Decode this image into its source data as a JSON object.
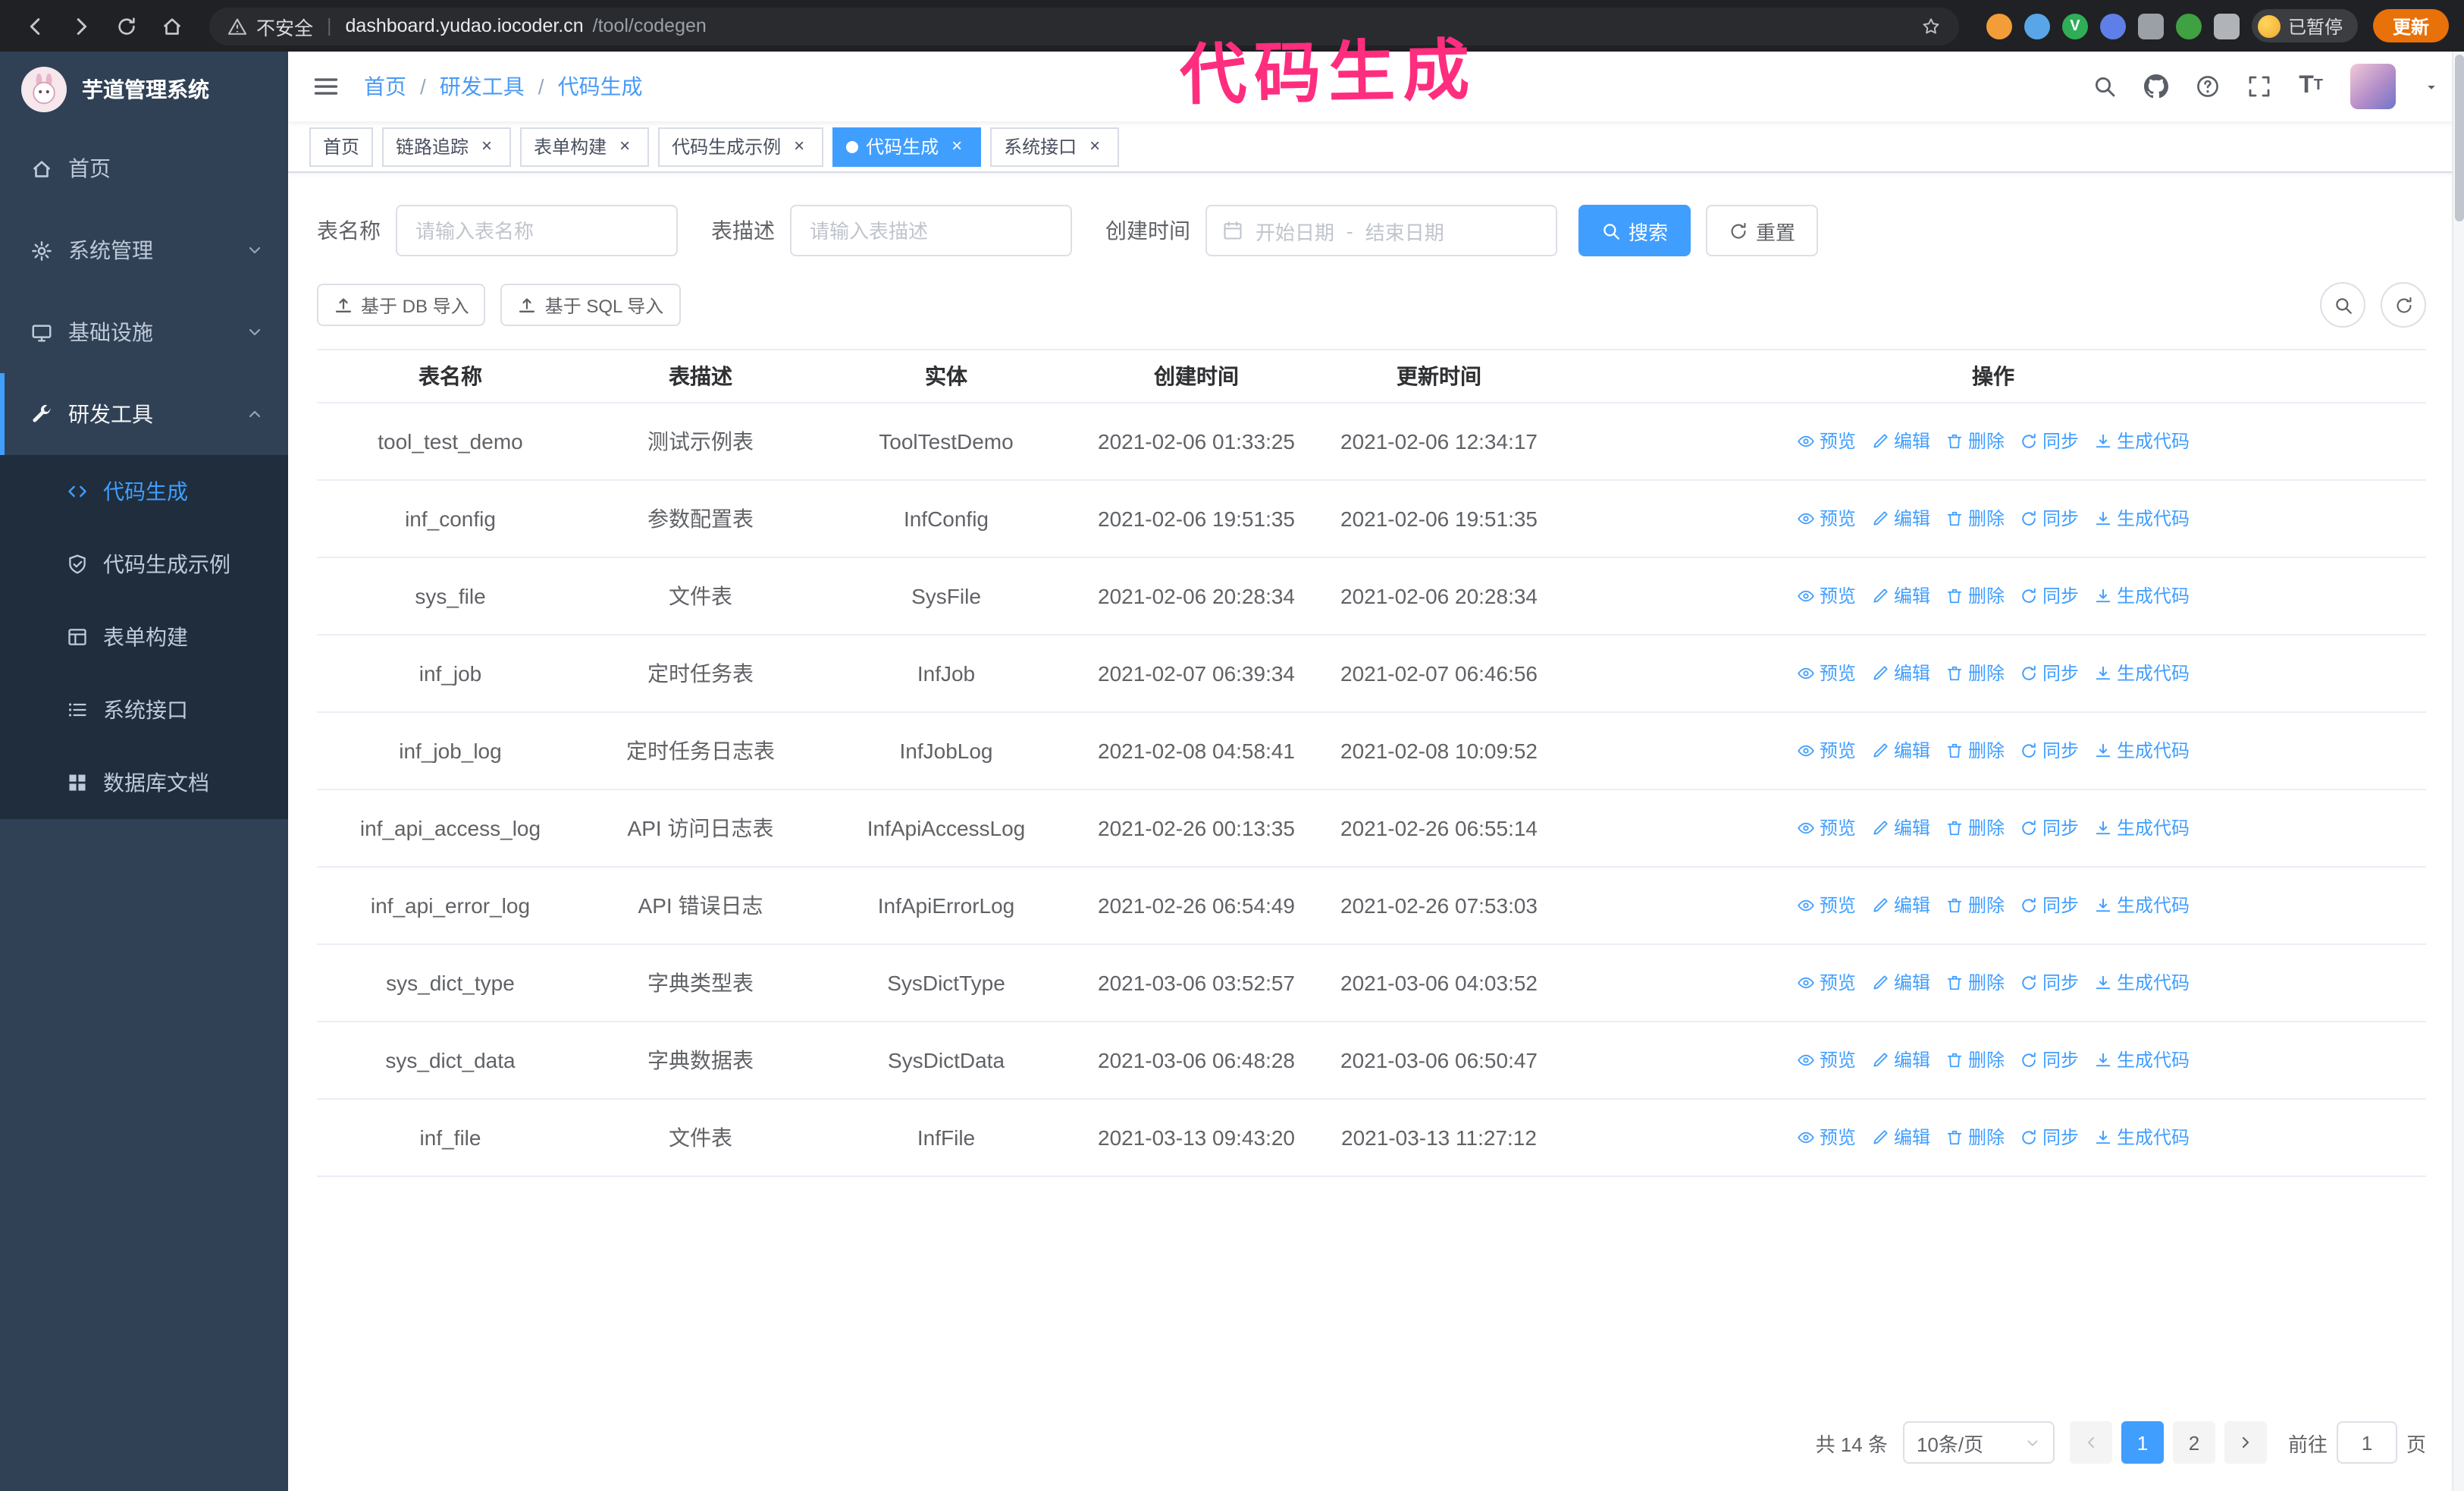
{
  "colors": {
    "accent": "#409eff",
    "sidebar_bg": "#304156",
    "submenu_bg": "#1f2d3d",
    "annotation_pink": "#ff2d7e",
    "update_button_orange": "#e8710a",
    "link_blue": "#4a9af5"
  },
  "browser": {
    "nav_icons": [
      "back",
      "forward",
      "reload",
      "home"
    ],
    "security_label": "不安全",
    "url_host": "dashboard.yudao.iocoder.cn",
    "url_path": "/tool/codegen",
    "extensions": [
      {
        "bg": "#f29d38",
        "shape": "circle",
        "glyph": ""
      },
      {
        "bg": "#58a6e8",
        "shape": "circle",
        "glyph": ""
      },
      {
        "bg": "#2fae57",
        "shape": "circle",
        "glyph": "V"
      },
      {
        "bg": "#5f7fe8",
        "shape": "circle",
        "glyph": ""
      },
      {
        "bg": "#9aa0a6",
        "shape": "square",
        "glyph": ""
      },
      {
        "bg": "#3fa142",
        "shape": "circle",
        "glyph": ""
      },
      {
        "bg": "#b0b3b8",
        "shape": "square",
        "glyph": ""
      }
    ],
    "paused_badge": "已暂停",
    "update_button": "更新"
  },
  "annotation": {
    "text": "代码生成"
  },
  "sidebar": {
    "logo_title": "芋道管理系统",
    "items": [
      {
        "key": "home",
        "label": "首页",
        "icon": "home",
        "chevron": null,
        "active": false
      },
      {
        "key": "system",
        "label": "系统管理",
        "icon": "gear",
        "chevron": "down",
        "active": false
      },
      {
        "key": "infra",
        "label": "基础设施",
        "icon": "monitor",
        "chevron": "down",
        "active": false
      },
      {
        "key": "devtools",
        "label": "研发工具",
        "icon": "wrench",
        "chevron": "up",
        "active": true
      }
    ],
    "subitems": [
      {
        "key": "codegen",
        "label": "代码生成",
        "icon": "code",
        "active": true
      },
      {
        "key": "codegen-example",
        "label": "代码生成示例",
        "icon": "shield",
        "active": false
      },
      {
        "key": "form-builder",
        "label": "表单构建",
        "icon": "form",
        "active": false
      },
      {
        "key": "api-doc",
        "label": "系统接口",
        "icon": "api",
        "active": false
      },
      {
        "key": "db-doc",
        "label": "数据库文档",
        "icon": "db",
        "active": false
      }
    ]
  },
  "breadcrumb": {
    "separator": "/",
    "items": [
      "首页",
      "研发工具",
      "代码生成"
    ]
  },
  "navbar": {
    "icons": [
      "search",
      "github",
      "question",
      "fullscreen",
      "font-size",
      "avatar",
      "caret-down"
    ]
  },
  "tabs": [
    {
      "key": "home",
      "label": "首页",
      "closable": false,
      "active": false
    },
    {
      "key": "trace",
      "label": "链路追踪",
      "closable": true,
      "active": false
    },
    {
      "key": "form-builder",
      "label": "表单构建",
      "closable": true,
      "active": false
    },
    {
      "key": "codegen-example",
      "label": "代码生成示例",
      "closable": true,
      "active": false
    },
    {
      "key": "codegen",
      "label": "代码生成",
      "closable": true,
      "active": true
    },
    {
      "key": "api-doc",
      "label": "系统接口",
      "closable": true,
      "active": false
    }
  ],
  "filters": {
    "table_name_label": "表名称",
    "table_name_placeholder": "请输入表名称",
    "table_desc_label": "表描述",
    "table_desc_placeholder": "请输入表描述",
    "create_time_label": "创建时间",
    "date_start_placeholder": "开始日期",
    "date_separator": "-",
    "date_end_placeholder": "结束日期",
    "search_button": "搜索",
    "reset_button": "重置"
  },
  "toolbar": {
    "import_db": "基于 DB 导入",
    "import_sql": "基于 SQL 导入"
  },
  "table": {
    "columns": [
      "表名称",
      "表描述",
      "实体",
      "创建时间",
      "更新时间",
      "操作"
    ],
    "actions": [
      {
        "key": "preview",
        "label": "预览",
        "icon": "eye"
      },
      {
        "key": "edit",
        "label": "编辑",
        "icon": "edit"
      },
      {
        "key": "delete",
        "label": "删除",
        "icon": "trash"
      },
      {
        "key": "sync",
        "label": "同步",
        "icon": "sync"
      },
      {
        "key": "generate",
        "label": "生成代码",
        "icon": "download"
      }
    ],
    "rows": [
      {
        "name": "tool_test_demo",
        "desc": "测试示例表",
        "entity": "ToolTestDemo",
        "created": "2021-02-06 01:33:25",
        "updated": "2021-02-06 12:34:17"
      },
      {
        "name": "inf_config",
        "desc": "参数配置表",
        "entity": "InfConfig",
        "created": "2021-02-06 19:51:35",
        "updated": "2021-02-06 19:51:35"
      },
      {
        "name": "sys_file",
        "desc": "文件表",
        "entity": "SysFile",
        "created": "2021-02-06 20:28:34",
        "updated": "2021-02-06 20:28:34"
      },
      {
        "name": "inf_job",
        "desc": "定时任务表",
        "entity": "InfJob",
        "created": "2021-02-07 06:39:34",
        "updated": "2021-02-07 06:46:56"
      },
      {
        "name": "inf_job_log",
        "desc": "定时任务日志表",
        "entity": "InfJobLog",
        "created": "2021-02-08 04:58:41",
        "updated": "2021-02-08 10:09:52"
      },
      {
        "name": "inf_api_access_log",
        "desc": "API 访问日志表",
        "entity": "InfApiAccessLog",
        "created": "2021-02-26 00:13:35",
        "updated": "2021-02-26 06:55:14"
      },
      {
        "name": "inf_api_error_log",
        "desc": "API 错误日志",
        "entity": "InfApiErrorLog",
        "created": "2021-02-26 06:54:49",
        "updated": "2021-02-26 07:53:03"
      },
      {
        "name": "sys_dict_type",
        "desc": "字典类型表",
        "entity": "SysDictType",
        "created": "2021-03-06 03:52:57",
        "updated": "2021-03-06 04:03:52"
      },
      {
        "name": "sys_dict_data",
        "desc": "字典数据表",
        "entity": "SysDictData",
        "created": "2021-03-06 06:48:28",
        "updated": "2021-03-06 06:50:47"
      },
      {
        "name": "inf_file",
        "desc": "文件表",
        "entity": "InfFile",
        "created": "2021-03-13 09:43:20",
        "updated": "2021-03-13 11:27:12"
      }
    ]
  },
  "pagination": {
    "total_text": "共 14 条",
    "page_size": "10条/页",
    "pages": [
      "1",
      "2"
    ],
    "active_page": "1",
    "goto_prefix": "前往",
    "goto_value": "1",
    "goto_suffix": "页"
  }
}
